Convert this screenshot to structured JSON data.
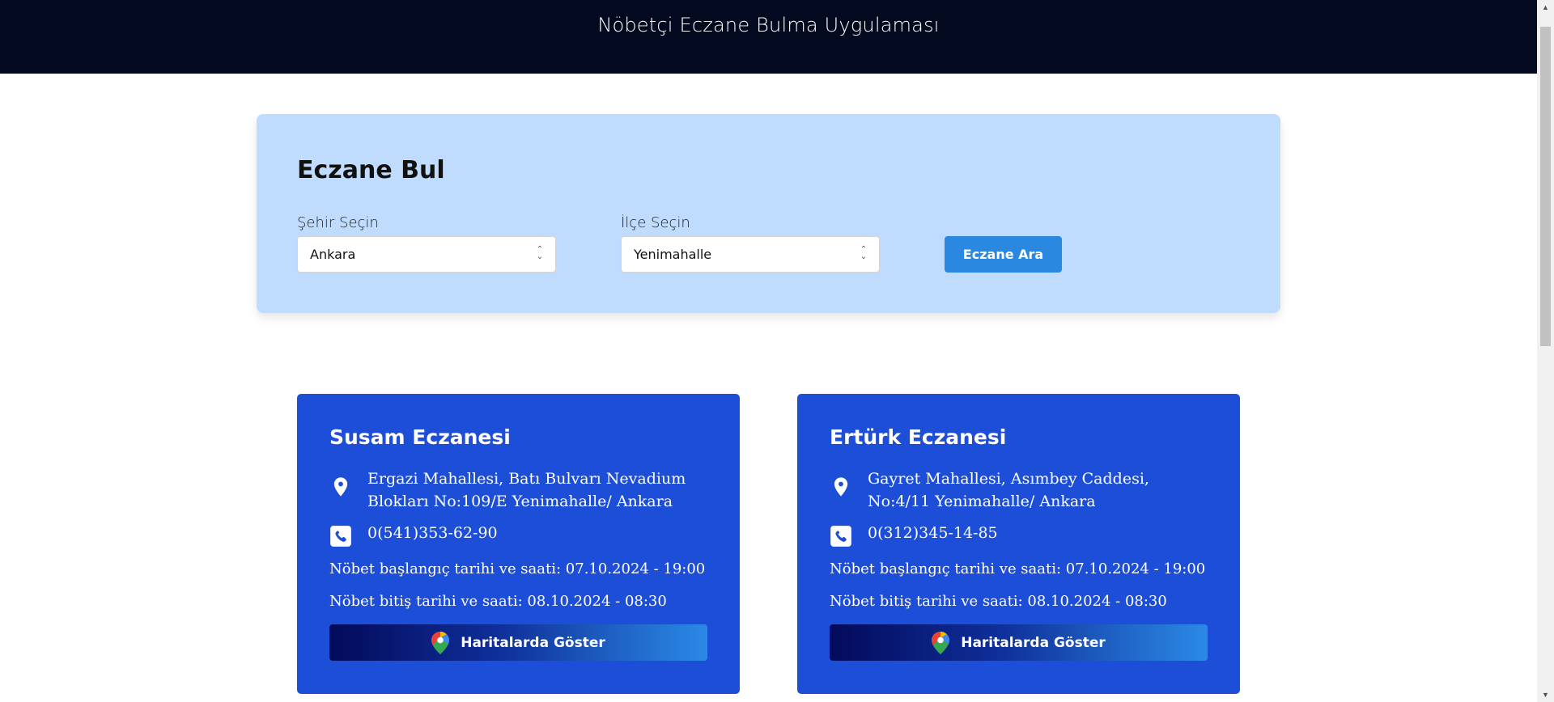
{
  "header": {
    "title": "Nöbetçi Eczane Bulma Uygulaması"
  },
  "search": {
    "title": "Eczane Bul",
    "city_label": "Şehir Seçin",
    "city_value": "Ankara",
    "district_label": "İlçe Seçin",
    "district_value": "Yenimahalle",
    "button_label": "Eczane Ara"
  },
  "pharmacies": [
    {
      "name": "Susam Eczanesi",
      "address": "Ergazi Mahallesi, Batı Bulvarı Nevadium Blokları No:109/E Yenimahalle/ Ankara",
      "phone": "0(541)353-62-90",
      "duty_start": "Nöbet başlangıç tarihi ve saati: 07.10.2024 - 19:00",
      "duty_end": "Nöbet bitiş tarihi ve saati: 08.10.2024 - 08:30",
      "map_button": "Haritalarda Göster"
    },
    {
      "name": "Ertürk Eczanesi",
      "address": "Gayret Mahallesi, Asımbey Caddesi, No:4/11 Yenimahalle/ Ankara",
      "phone": "0(312)345-14-85",
      "duty_start": "Nöbet başlangıç tarihi ve saati: 07.10.2024 - 19:00",
      "duty_end": "Nöbet bitiş tarihi ve saati: 08.10.2024 - 08:30",
      "map_button": "Haritalarda Göster"
    }
  ],
  "icons": {
    "location": "location-pin-icon",
    "phone": "phone-icon",
    "maps": "google-maps-icon"
  },
  "colors": {
    "header_bg": "#030a1f",
    "search_card_bg": "#bfdbfe",
    "search_button": "#2b88e1",
    "pharmacy_card_bg": "#1d4ed8"
  }
}
